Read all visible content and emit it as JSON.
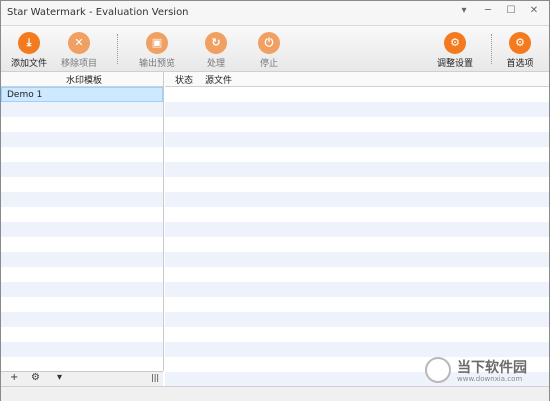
{
  "window": {
    "title": "Star Watermark - Evaluation Version",
    "minimize": "▾",
    "restore": "─",
    "maximize": "☐",
    "close": "✕"
  },
  "toolbar": {
    "add_files": "添加文件",
    "remove_item": "移除项目",
    "output_preview": "输出预览",
    "process": "处理",
    "stop": "停止",
    "adjust_settings": "调整设置",
    "preferences": "首选项"
  },
  "left_panel": {
    "header": "水印模板",
    "items": [
      "Demo 1"
    ],
    "add_label": "+",
    "gear_label": "⚙",
    "dropdown_label": "▾",
    "grip_label": "|||"
  },
  "right_panel": {
    "columns": [
      "状态",
      "源文件"
    ]
  },
  "watermark": {
    "brand": "当下软件园",
    "url": "www.downxia.com"
  }
}
